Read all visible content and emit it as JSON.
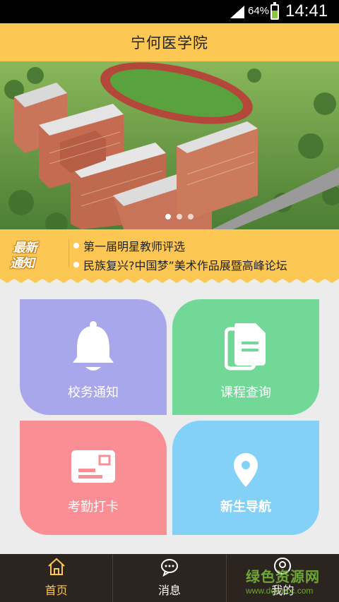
{
  "status_bar": {
    "battery_percent": "64%",
    "time": "14:41"
  },
  "header": {
    "title": "宁何医学院"
  },
  "banner": {
    "slide_count": 3,
    "active_slide": 1
  },
  "notice": {
    "badge_line1": "最新",
    "badge_line2": "通知",
    "items": [
      "第一届明星教师评选",
      "民族复兴?中国梦”美术作品展暨高峰论坛"
    ]
  },
  "tiles": {
    "notice_label": "校务通知",
    "course_label": "课程查询",
    "attendance_label": "考勤打卡",
    "navigation_label": "新生导航"
  },
  "tabbar": {
    "home_label": "首页",
    "messages_label": "消息",
    "mine_label": "我的"
  },
  "watermark": {
    "text": "绿色资源网",
    "url": "www.downcc.com"
  },
  "colors": {
    "accent": "#fcc752",
    "tile_notice": "#a9a7ec",
    "tile_course": "#72d898",
    "tile_attendance": "#f98f95",
    "tile_navigation": "#84d1f7",
    "tabbar_bg": "#2b241f"
  },
  "icons": {
    "home": "home-icon",
    "messages": "chat-bubble-icon",
    "mine": "user-icon",
    "notice": "bell-icon",
    "course": "documents-icon",
    "attendance": "card-icon",
    "navigation": "map-pin-icon"
  }
}
